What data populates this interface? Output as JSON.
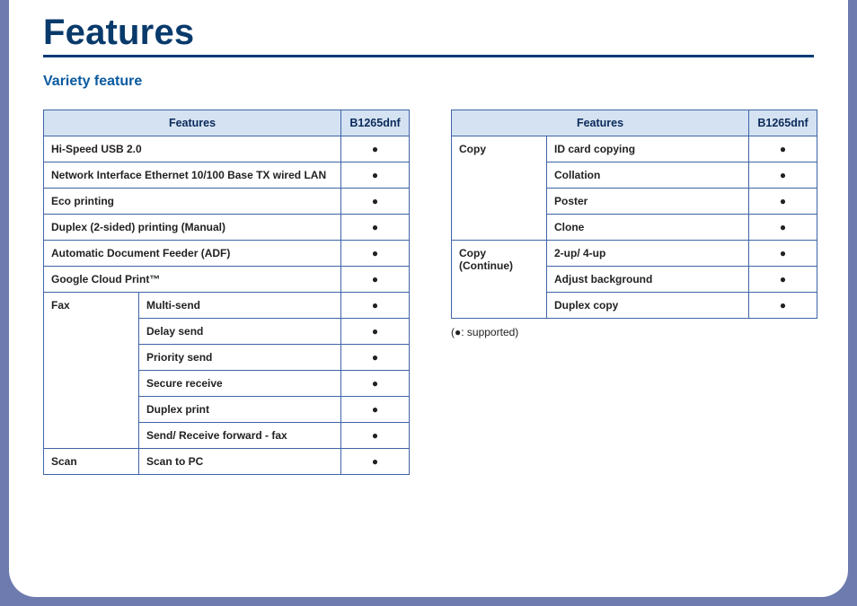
{
  "page": {
    "title": "Features",
    "subtitle": "Variety feature",
    "legend": "(●: supported)",
    "bullet": "●",
    "columnHeaders": {
      "features": "Features",
      "model": "B1265dnf"
    }
  },
  "table1": {
    "rows": [
      {
        "type": "flat",
        "label": "Hi-Speed USB 2.0",
        "mark": "●"
      },
      {
        "type": "flat",
        "label": "Network Interface Ethernet 10/100 Base TX wired LAN",
        "mark": "●"
      },
      {
        "type": "flat",
        "label": "Eco printing",
        "mark": "●"
      },
      {
        "type": "flat",
        "label": "Duplex (2-sided) printing (Manual)",
        "mark": "●"
      },
      {
        "type": "flat",
        "label": "Automatic Document Feeder (ADF)",
        "mark": "●"
      },
      {
        "type": "flat",
        "label": "Google Cloud Print™",
        "mark": "●"
      },
      {
        "type": "groupStart",
        "group": "Fax",
        "span": 6,
        "label": "Multi-send",
        "mark": "●"
      },
      {
        "type": "sub",
        "label": "Delay send",
        "mark": "●"
      },
      {
        "type": "sub",
        "label": "Priority send",
        "mark": "●"
      },
      {
        "type": "sub",
        "label": "Secure receive",
        "mark": "●"
      },
      {
        "type": "sub",
        "label": "Duplex print",
        "mark": "●"
      },
      {
        "type": "sub",
        "label": "Send/ Receive forward - fax",
        "mark": "●"
      },
      {
        "type": "groupStart",
        "group": "Scan",
        "span": 1,
        "label": "Scan to PC",
        "mark": "●"
      }
    ]
  },
  "table2": {
    "rows": [
      {
        "type": "groupStart",
        "group": "Copy",
        "span": 4,
        "label": "ID card copying",
        "mark": "●"
      },
      {
        "type": "sub",
        "label": "Collation",
        "mark": "●"
      },
      {
        "type": "sub",
        "label": "Poster",
        "mark": "●"
      },
      {
        "type": "sub",
        "label": "Clone",
        "mark": "●"
      },
      {
        "type": "groupStart",
        "group": "Copy (Continue)",
        "span": 3,
        "label": "2-up/ 4-up",
        "mark": "●"
      },
      {
        "type": "sub",
        "label": "Adjust background",
        "mark": "●"
      },
      {
        "type": "sub",
        "label": "Duplex copy",
        "mark": "●"
      }
    ]
  }
}
